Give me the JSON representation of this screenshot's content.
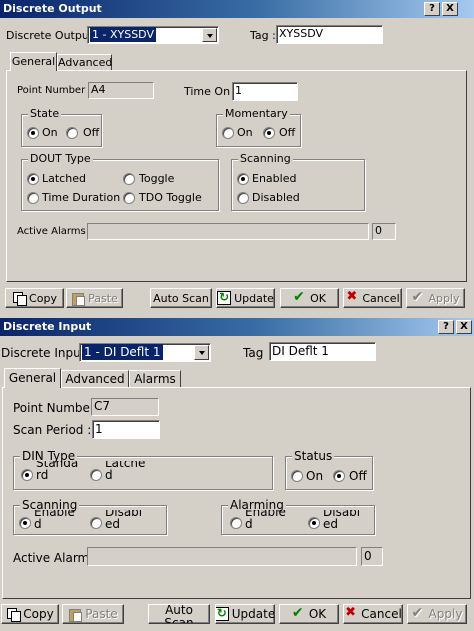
{
  "output_window": {
    "title": "Discrete Output",
    "title_buttons": [
      "?",
      "X"
    ],
    "selector_label": "Discrete Outputs :",
    "selector_value": "1 - XYSSDV",
    "tag_label": "Tag :",
    "tag_value": "XYSSDV",
    "tabs": [
      {
        "label": "General"
      },
      {
        "label": "Advanced"
      }
    ],
    "point_number_label": "Point Number :",
    "point_number_value": "A4",
    "time_on_label": "Time On :",
    "time_on_value": "1",
    "state": {
      "title": "State",
      "options": [
        {
          "label": "On",
          "selected": true
        },
        {
          "label": "Off",
          "selected": false
        }
      ]
    },
    "momentary": {
      "title": "Momentary",
      "options": [
        {
          "label": "On",
          "selected": false
        },
        {
          "label": "Off",
          "selected": true
        }
      ]
    },
    "dout_type": {
      "title": "DOUT Type",
      "options": [
        {
          "label": "Latched",
          "selected": true
        },
        {
          "label": "Toggle",
          "selected": false
        },
        {
          "label": "Time Duration",
          "selected": false
        },
        {
          "label": "TDO Toggle",
          "selected": false
        }
      ]
    },
    "scanning": {
      "title": "Scanning",
      "options": [
        {
          "label": "Enabled",
          "selected": true
        },
        {
          "label": "Disabled",
          "selected": false
        }
      ]
    },
    "active_alarms_label": "Active Alarms :",
    "active_alarms_count": "0",
    "buttons": {
      "copy": "Copy",
      "paste": "Paste",
      "auto_scan": "Auto Scan",
      "update": "Update",
      "ok": "OK",
      "cancel": "Cancel",
      "apply": "Apply"
    }
  },
  "input_window": {
    "title": "Discrete Input",
    "title_buttons": [
      "?",
      "X"
    ],
    "selector_label": "Discrete Inputs",
    "selector_value": "1 - DI Deflt 1",
    "tag_label": "Tag",
    "tag_value": "DI Deflt 1",
    "tabs": [
      {
        "label": "General"
      },
      {
        "label": "Advanced"
      },
      {
        "label": "Alarms"
      }
    ],
    "point_number_label": "Point Number",
    "point_number_value": "C7",
    "scan_period_label": "Scan Period :",
    "scan_period_value": "1",
    "din_type": {
      "title": "DIN Type",
      "options": [
        {
          "label": "Standard",
          "selected": true
        },
        {
          "label": "Latched",
          "selected": false
        }
      ]
    },
    "status": {
      "title": "Status",
      "options": [
        {
          "label": "On",
          "selected": false
        },
        {
          "label": "Off",
          "selected": true
        }
      ]
    },
    "scanning": {
      "title": "Scanning",
      "options": [
        {
          "label": "Enabled",
          "selected": true
        },
        {
          "label": "Disabled",
          "selected": false
        }
      ]
    },
    "alarming": {
      "title": "Alarming",
      "options": [
        {
          "label": "Enabled",
          "selected": false
        },
        {
          "label": "Disabled",
          "selected": true
        }
      ]
    },
    "active_alarm_label": "Active Alarm",
    "active_alarm_count": "0",
    "buttons": {
      "copy": "Copy",
      "paste": "Paste",
      "auto_scan": "Auto Scan",
      "update": "Update",
      "ok": "OK",
      "cancel": "Cancel",
      "apply": "Apply"
    }
  }
}
